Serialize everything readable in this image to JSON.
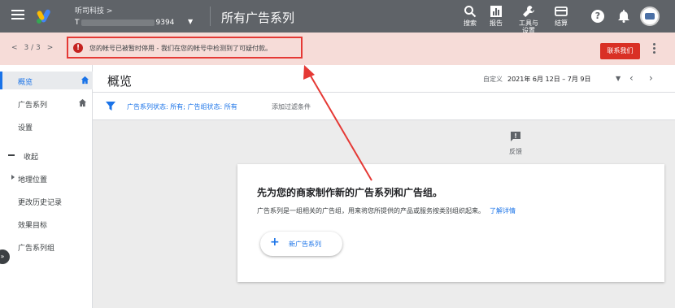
{
  "header": {
    "account_name": "听司科技 >",
    "account_id_prefix": "T",
    "account_id_suffix": "9394",
    "page_title": "所有广告系列",
    "tools": [
      {
        "icon": "search-icon",
        "label": "搜索"
      },
      {
        "icon": "report-icon",
        "label": "报告"
      },
      {
        "icon": "wrench-icon",
        "label": "工具与设置"
      },
      {
        "icon": "billing-icon",
        "label": "结算"
      }
    ],
    "help_glyph": "?"
  },
  "alert": {
    "pager_prev": "<",
    "pager_count": "3 / 3",
    "pager_next": ">",
    "icon_glyph": "!",
    "message": "您的帐号已被暂时停用 - 我们在您的帐号中检测到了可疑付款。",
    "contact_label": "联系我们",
    "accent_color": "#d93025"
  },
  "sidebar": {
    "items": [
      {
        "label": "概览"
      },
      {
        "label": "广告系列"
      },
      {
        "label": "设置"
      },
      {
        "label": "收起"
      },
      {
        "label": "地理位置"
      },
      {
        "label": "更改历史记录"
      },
      {
        "label": "效果目标"
      },
      {
        "label": "广告系列组"
      }
    ],
    "expand_glyph": "»"
  },
  "main": {
    "title": "概览",
    "date_label": "自定义",
    "date_value": "2021年 6月 12日 – 7月 9日",
    "filter_text": "广告系列状态: 所有; 广告组状态: 所有",
    "add_filter": "添加过滤条件",
    "feedback_label": "反馈"
  },
  "card": {
    "title": "先为您的商家制作新的广告系列和广告组。",
    "description": "广告系列是一组相关的广告组，用来将您所提供的产品或服务按类别组织起来。",
    "learn_more": "了解详情",
    "new_campaign_label": "新广告系列",
    "plus_glyph": "+"
  },
  "colors": {
    "accent": "#1a73e8",
    "annotation": "#e53935"
  }
}
